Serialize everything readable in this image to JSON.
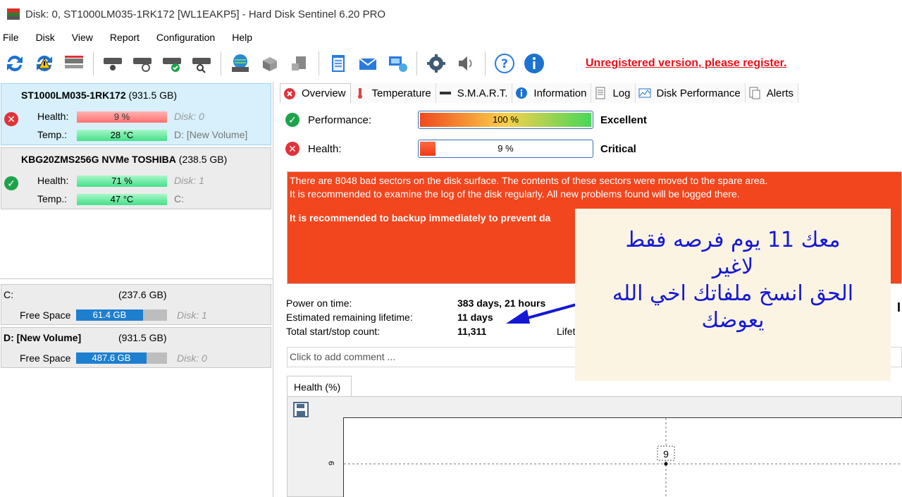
{
  "window": {
    "title": "Disk: 0, ST1000LM035-1RK172 [WL1EAKP5]  -  Hard Disk Sentinel 6.20 PRO"
  },
  "menu": [
    "File",
    "Disk",
    "View",
    "Report",
    "Configuration",
    "Help"
  ],
  "toolbar": {
    "register_text": "Unregistered version, please register."
  },
  "disks": [
    {
      "model": "ST1000LM035-1RK172",
      "size": "(931.5 GB)",
      "health_label": "Health:",
      "health_value": "9 %",
      "health_percent": 9,
      "temp_label": "Temp.:",
      "temp_value": "28 °C",
      "disk_index": "Disk: 0",
      "volume": "D: [New Volume]"
    },
    {
      "model": "KBG20ZMS256G NVMe TOSHIBA",
      "size": "(238.5 GB)",
      "health_label": "Health:",
      "health_value": "71 %",
      "health_percent": 71,
      "temp_label": "Temp.:",
      "temp_value": "47 °C",
      "disk_index": "Disk: 1",
      "volume": "C:"
    }
  ],
  "volumes": [
    {
      "name": "C:",
      "size": "(237.6 GB)",
      "free_label": "Free Space",
      "free_value": "61.4 GB",
      "free_percent": 26,
      "disk_index": "Disk: 1"
    },
    {
      "name": "D: [New Volume]",
      "size": "(931.5 GB)",
      "free_label": "Free Space",
      "free_value": "487.6 GB",
      "free_percent": 52,
      "disk_index": "Disk: 0"
    }
  ],
  "tabs": [
    "Overview",
    "Temperature",
    "S.M.A.R.T.",
    "Information",
    "Log",
    "Disk Performance",
    "Alerts"
  ],
  "overview": {
    "performance_label": "Performance:",
    "performance_value": "100 %",
    "performance_percent": 100,
    "performance_status": "Excellent",
    "health_label": "Health:",
    "health_value": "9 %",
    "health_percent": 9,
    "health_status": "Critical",
    "alert_line1": "There are 8048 bad sectors on the disk surface. The contents of these sectors were moved to the spare area.",
    "alert_line2": "It is recommended to examine the log of the disk regularly. All new problems found will be logged there.",
    "alert_line3": "It is recommended to backup immediately to prevent da",
    "power_on_label": "Power on time:",
    "power_on_value": "383 days, 21 hours",
    "remaining_label": "Estimated remaining lifetime:",
    "remaining_value": "11 days",
    "startstop_label": "Total start/stop count:",
    "startstop_value": "11,311",
    "lifetime_cut": "Lifet",
    "edge_mark": "I",
    "comment_placeholder": "Click to add comment ..."
  },
  "chart_data": {
    "type": "line",
    "title": "Health (%)",
    "ytick": "9",
    "point_label": "9",
    "series": [
      {
        "values": [
          9
        ]
      }
    ]
  },
  "note": {
    "line1": "معك 11 يوم  فرصه فقط",
    "line2": "لاغير",
    "line3": "الحق انسخ ملفاتك اخي الله",
    "line4": "يعوضك"
  },
  "colors": {
    "alert_bg": "#f2461e",
    "register": "#e8101a",
    "note_text": "#1418d6"
  }
}
